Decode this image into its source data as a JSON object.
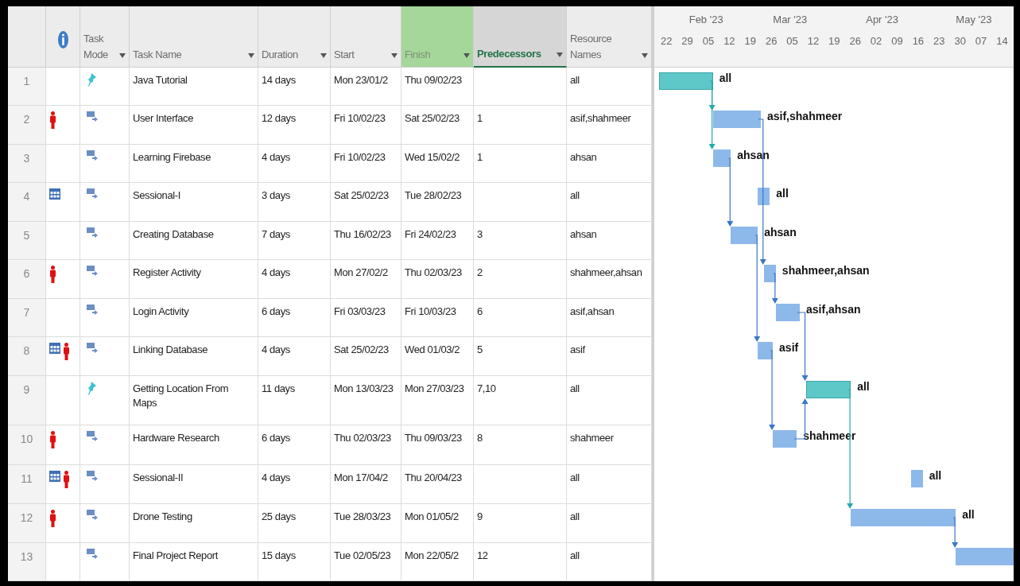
{
  "columns": [
    {
      "label": "Task Mode",
      "highlighted": false,
      "selected": false
    },
    {
      "label": "Task Name",
      "highlighted": false,
      "selected": false
    },
    {
      "label": "Duration",
      "highlighted": false,
      "selected": false
    },
    {
      "label": "Start",
      "highlighted": false,
      "selected": false
    },
    {
      "label": "Finish",
      "highlighted": true,
      "selected": false
    },
    {
      "label": "Predecessors",
      "highlighted": false,
      "selected": true
    },
    {
      "label": "Resource Names",
      "highlighted": false,
      "selected": false
    }
  ],
  "timeline": {
    "months": [
      "Feb '23",
      "Mar '23",
      "Apr '23",
      "May '23"
    ],
    "weeks": [
      "22",
      "29",
      "05",
      "12",
      "19",
      "26",
      "05",
      "12",
      "19",
      "26",
      "02",
      "09",
      "16",
      "23",
      "30",
      "07",
      "14"
    ]
  },
  "rows": [
    {
      "id": "1",
      "indicators": [],
      "kind": "manual",
      "name": "Java Tutorial",
      "duration": "14 days",
      "start": "Mon 23/01/2",
      "finish": "Thu 09/02/23",
      "resources": "all",
      "bar_label": "all"
    },
    {
      "id": "2",
      "indicators": [
        {
          "kind": "person"
        }
      ],
      "kind": "auto",
      "name": "User Interface",
      "duration": "12 days",
      "start": "Fri 10/02/23",
      "finish": "Sat 25/02/23",
      "predecessors": "1",
      "resources": "asif,shahmeer",
      "bar_label": "asif,shahmeer"
    },
    {
      "id": "3",
      "indicators": [],
      "kind": "auto",
      "name": "Learning Firebase",
      "duration": "4 days",
      "start": "Fri 10/02/23",
      "finish": "Wed 15/02/2",
      "predecessors": "1",
      "resources": "ahsan",
      "bar_label": "ahsan"
    },
    {
      "id": "4",
      "indicators": [
        {
          "kind": "calendar"
        }
      ],
      "kind": "auto",
      "name": "Sessional-I",
      "duration": "3 days",
      "start": "Sat 25/02/23",
      "finish": "Tue 28/02/23",
      "resources": "all",
      "bar_label": "all"
    },
    {
      "id": "5",
      "indicators": [],
      "kind": "auto",
      "name": "Creating Database",
      "duration": "7 days",
      "start": "Thu 16/02/23",
      "finish": "Fri 24/02/23",
      "predecessors": "3",
      "resources": "ahsan",
      "bar_label": "ahsan"
    },
    {
      "id": "6",
      "indicators": [
        {
          "kind": "person"
        }
      ],
      "kind": "auto",
      "name": "Register Activity",
      "duration": "4 days",
      "start": "Mon 27/02/2",
      "finish": "Thu 02/03/23",
      "predecessors": "2",
      "resources": "shahmeer,ahsan",
      "bar_label": "shahmeer,ahsan"
    },
    {
      "id": "7",
      "indicators": [],
      "kind": "auto",
      "name": "Login Activity",
      "duration": "6 days",
      "start": "Fri 03/03/23",
      "finish": "Fri 10/03/23",
      "predecessors": "6",
      "resources": "asif,ahsan",
      "bar_label": "asif,ahsan"
    },
    {
      "id": "8",
      "indicators": [
        {
          "kind": "calendar"
        },
        {
          "kind": "person"
        }
      ],
      "kind": "auto",
      "name": "Linking Database",
      "duration": "4 days",
      "start": "Sat 25/02/23",
      "finish": "Wed 01/03/2",
      "predecessors": "5",
      "resources": "asif",
      "bar_label": "asif"
    },
    {
      "id": "9",
      "indicators": [],
      "kind": "manual",
      "name": "Getting Location From Maps",
      "duration": "11 days",
      "start": "Mon 13/03/23",
      "finish": "Mon 27/03/23",
      "predecessors": "7,10",
      "resources": "all",
      "bar_label": "all"
    },
    {
      "id": "10",
      "indicators": [
        {
          "kind": "person"
        }
      ],
      "kind": "auto",
      "name": "Hardware Research",
      "duration": "6 days",
      "start": "Thu 02/03/23",
      "finish": "Thu 09/03/23",
      "predecessors": "8",
      "resources": "shahmeer",
      "bar_label": "shahmeer"
    },
    {
      "id": "11",
      "indicators": [
        {
          "kind": "calendar"
        },
        {
          "kind": "person"
        }
      ],
      "kind": "auto",
      "name": "Sessional-II",
      "duration": "4 days",
      "start": "Mon 17/04/2",
      "finish": "Thu 20/04/23",
      "resources": "all",
      "bar_label": "all"
    },
    {
      "id": "12",
      "indicators": [
        {
          "kind": "person"
        }
      ],
      "kind": "auto",
      "name": "Drone Testing",
      "duration": "25 days",
      "start": "Tue 28/03/23",
      "finish": "Mon 01/05/2",
      "predecessors": "9",
      "resources": "all",
      "bar_label": "all"
    },
    {
      "id": "13",
      "indicators": [],
      "kind": "auto",
      "name": "Final Project Report",
      "duration": "15 days",
      "start": "Tue 02/05/23",
      "finish": "Mon 22/05/2",
      "predecessors": "12",
      "resources": "all"
    }
  ]
}
